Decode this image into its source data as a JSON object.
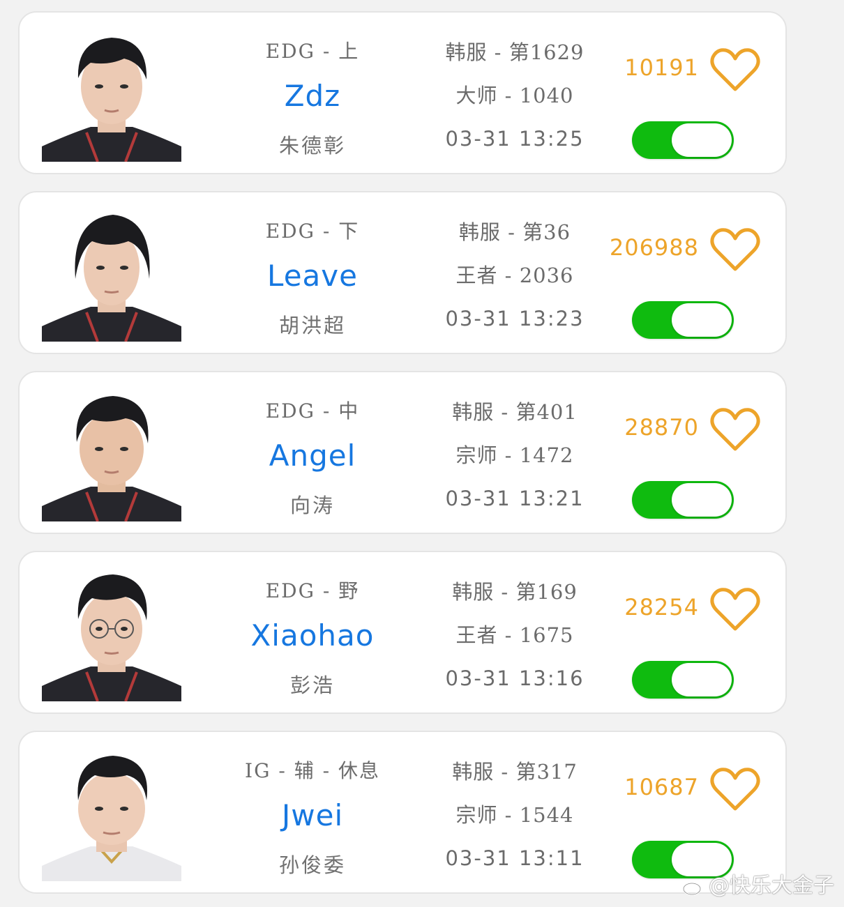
{
  "colors": {
    "accent_name": "#1677e0",
    "likes": "#eda42a",
    "heart": "#eda42a",
    "toggle_on": "#0fbb0f",
    "card_bg": "#ffffff",
    "page_bg": "#f2f2f2"
  },
  "players": [
    {
      "team_role": "EDG - 上",
      "ign": "Zdz",
      "real_name": "朱德彰",
      "server_rank": "韩服 - 第1629",
      "tier_lp": "大师 - 1040",
      "time": "03-31 13:25",
      "likes": "10191",
      "jersey": "dark",
      "toggle_on": true
    },
    {
      "team_role": "EDG - 下",
      "ign": "Leave",
      "real_name": "胡洪超",
      "server_rank": "韩服 - 第36",
      "tier_lp": "王者 - 2036",
      "time": "03-31 13:23",
      "likes": "206988",
      "jersey": "dark",
      "toggle_on": true
    },
    {
      "team_role": "EDG - 中",
      "ign": "Angel",
      "real_name": "向涛",
      "server_rank": "韩服 - 第401",
      "tier_lp": "宗师 - 1472",
      "time": "03-31 13:21",
      "likes": "28870",
      "jersey": "dark",
      "toggle_on": true
    },
    {
      "team_role": "EDG - 野",
      "ign": "Xiaohao",
      "real_name": "彭浩",
      "server_rank": "韩服 - 第169",
      "tier_lp": "王者 - 1675",
      "time": "03-31 13:16",
      "likes": "28254",
      "jersey": "dark",
      "toggle_on": true
    },
    {
      "team_role": "IG - 辅 - 休息",
      "ign": "Jwei",
      "real_name": "孙俊委",
      "server_rank": "韩服 - 第317",
      "tier_lp": "宗师 - 1544",
      "time": "03-31 13:11",
      "likes": "10687",
      "jersey": "light",
      "toggle_on": true
    }
  ],
  "watermark": {
    "text": "@快乐大金子",
    "icon": "weibo-icon"
  }
}
